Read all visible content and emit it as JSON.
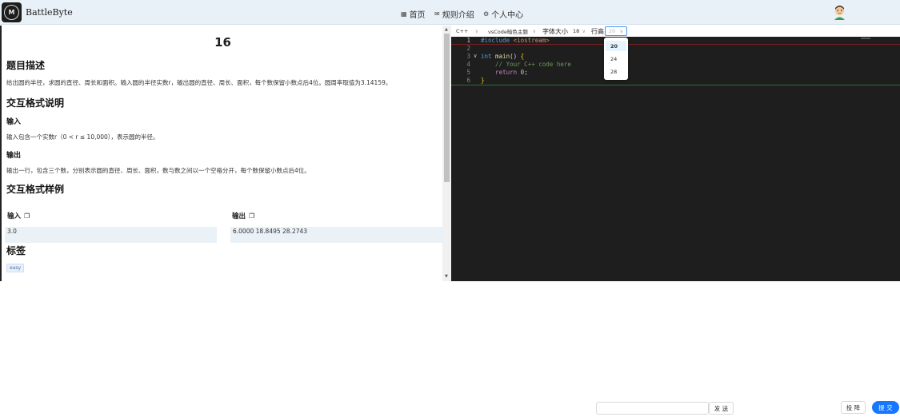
{
  "header": {
    "brand": "BattleByte",
    "logo_text": "M",
    "nav": [
      {
        "label": "首页",
        "icon": "home-icon"
      },
      {
        "label": "规则介绍",
        "icon": "mail-icon"
      },
      {
        "label": "个人中心",
        "icon": "gear-icon"
      }
    ]
  },
  "problem": {
    "title": "16",
    "desc_heading": "题目描述",
    "desc": "给出圆的半径，求圆的直径、周长和面积。输入圆的半径实数r，输出圆的直径、周长、面积，每个数保留小数点后4位。圆周率取值为3.14159。",
    "io_heading": "交互格式说明",
    "input_heading": "输入",
    "input_desc": "输入包含一个实数r（0 < r ≤ 10,000），表示圆的半径。",
    "output_heading": "输出",
    "output_desc": "输出一行，包含三个数，分别表示圆的直径、周长、面积，数与数之间以一个空格分开，每个数保留小数点后4位。",
    "sample_heading": "交互格式样例",
    "sample_input_label": "输入",
    "sample_output_label": "输出",
    "sample_input": "3.0",
    "sample_output": "6.0000 18.8495 28.2743",
    "tags_heading": "标签",
    "tag": "easy"
  },
  "editor_toolbar": {
    "language": "C++",
    "theme": "vsCode暗色主题",
    "font_size_label": "字体大小",
    "font_size": "18",
    "line_height_label": "行高",
    "line_height": "20"
  },
  "line_height_options": [
    "20",
    "24",
    "28"
  ],
  "code": {
    "line_numbers": [
      "1",
      "2",
      "3",
      "4",
      "5",
      "6"
    ],
    "include_kw": "#include",
    "include_arg": " <iostream>",
    "int_kw": "int",
    "main_fn": " main",
    "main_rest": "() ",
    "open_brace": "{",
    "comment": "    // Your C++ code here",
    "return_kw": "    return",
    "zero": " 0",
    "semi": ";",
    "close_brace": "}"
  },
  "actions": {
    "send": "发 送",
    "give_up": "投 降",
    "submit": "提 交",
    "chat_placeholder": ""
  }
}
